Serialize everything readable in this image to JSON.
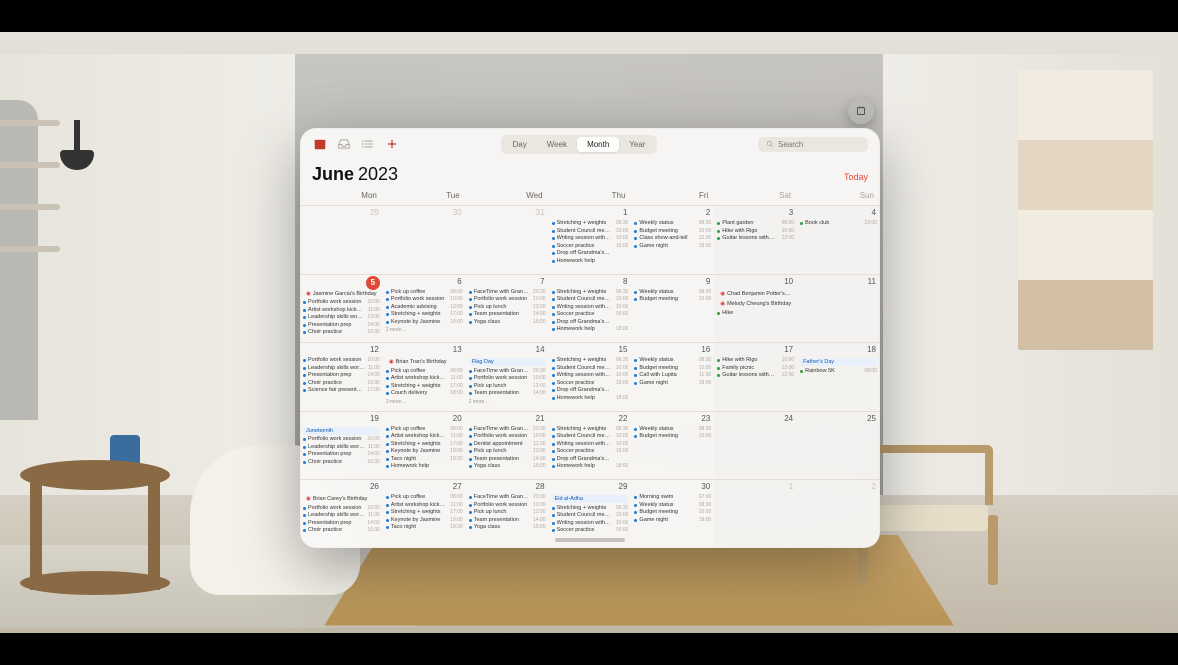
{
  "toolbar": {
    "view_modes": [
      "Day",
      "Week",
      "Month",
      "Year"
    ],
    "active_mode": "Month",
    "search_placeholder": "Search"
  },
  "header": {
    "month": "June",
    "year": "2023",
    "today_label": "Today"
  },
  "days_of_week": [
    "Mon",
    "Tue",
    "Wed",
    "Thu",
    "Fri",
    "Sat",
    "Sun"
  ],
  "today": 5,
  "weeks": [
    [
      {
        "n": 29,
        "dim": true,
        "events": []
      },
      {
        "n": 30,
        "dim": true,
        "events": []
      },
      {
        "n": 31,
        "dim": true,
        "events": []
      },
      {
        "n": 1,
        "events": [
          {
            "t": "Stretching + weights",
            "time": "06:30"
          },
          {
            "t": "Student Council mee…",
            "time": "10:00"
          },
          {
            "t": "Writing session with…",
            "time": "10:00"
          },
          {
            "t": "Soccer practice",
            "time": "16:00"
          },
          {
            "t": "Drop off Grandma's…",
            "time": ""
          },
          {
            "t": "Homework help",
            "time": ""
          }
        ]
      },
      {
        "n": 2,
        "events": [
          {
            "t": "Weekly status",
            "time": "08:30"
          },
          {
            "t": "Budget meeting",
            "time": "10:00"
          },
          {
            "t": "Class show-and-tell",
            "time": "12:00"
          },
          {
            "t": "Game night",
            "time": "19:00"
          }
        ]
      },
      {
        "n": 3,
        "events": [
          {
            "t": "Plant garden",
            "time": "09:00",
            "c": "green"
          },
          {
            "t": "Hike with Rigo",
            "time": "10:00",
            "c": "green"
          },
          {
            "t": "Guitar lessons with…",
            "time": "12:00",
            "c": "green"
          }
        ]
      },
      {
        "n": 4,
        "events": [
          {
            "t": "Book club",
            "time": "12:00",
            "c": "green"
          }
        ]
      }
    ],
    [
      {
        "n": 5,
        "today": true,
        "alldays": [
          {
            "kind": "bday",
            "t": "Jasmine Garcia's Birthday"
          }
        ],
        "events": [
          {
            "t": "Portfolio work session",
            "time": "10:00"
          },
          {
            "t": "Artist workshop kick…",
            "time": "11:00"
          },
          {
            "t": "Leadership skills wor…",
            "time": "13:00"
          },
          {
            "t": "Presentation prep",
            "time": "14:00"
          },
          {
            "t": "Choir practice",
            "time": "16:30"
          }
        ]
      },
      {
        "n": 6,
        "events": [
          {
            "t": "Pick up coffee",
            "time": "08:00"
          },
          {
            "t": "Portfolio work session",
            "time": "10:00"
          },
          {
            "t": "Academic advising",
            "time": "13:00"
          },
          {
            "t": "Stretching + weights",
            "time": "17:00"
          },
          {
            "t": "Keynote by Jasmine",
            "time": "19:00"
          }
        ],
        "more": "2 more…"
      },
      {
        "n": 7,
        "events": [
          {
            "t": "FaceTime with Gran…",
            "time": "20:30"
          },
          {
            "t": "Portfolio work session",
            "time": "10:00"
          },
          {
            "t": "Pick up lunch",
            "time": "12:00"
          },
          {
            "t": "Team presentation",
            "time": "14:00"
          },
          {
            "t": "Yoga class",
            "time": "15:00"
          }
        ]
      },
      {
        "n": 8,
        "events": [
          {
            "t": "Stretching + weights",
            "time": "06:30"
          },
          {
            "t": "Student Council mee…",
            "time": "10:00"
          },
          {
            "t": "Writing session with…",
            "time": "10:00"
          },
          {
            "t": "Soccer practice",
            "time": "16:00"
          },
          {
            "t": "Drop off Grandma's…",
            "time": ""
          },
          {
            "t": "Homework help",
            "time": "18:00"
          }
        ]
      },
      {
        "n": 9,
        "events": [
          {
            "t": "Weekly status",
            "time": "08:30"
          },
          {
            "t": "Budget meeting",
            "time": "10:00"
          }
        ]
      },
      {
        "n": 10,
        "alldays": [
          {
            "kind": "bday",
            "t": "Chad Benjamin Potter's Bi…"
          },
          {
            "kind": "bday",
            "t": "Melody Cheung's Birthday"
          }
        ],
        "events": [
          {
            "t": "Hike",
            "time": "",
            "c": "green"
          }
        ]
      },
      {
        "n": 11,
        "events": []
      }
    ],
    [
      {
        "n": 12,
        "events": [
          {
            "t": "Portfolio work session",
            "time": "10:00"
          },
          {
            "t": "Leadership skills wor…",
            "time": "11:00"
          },
          {
            "t": "Presentation prep",
            "time": "14:00"
          },
          {
            "t": "Choir practice",
            "time": "16:30"
          },
          {
            "t": "Science fair presenta…",
            "time": "17:00"
          }
        ]
      },
      {
        "n": 13,
        "alldays": [
          {
            "kind": "bday",
            "t": "Brian Tran's Birthday"
          }
        ],
        "events": [
          {
            "t": "Pick up coffee",
            "time": "08:00"
          },
          {
            "t": "Artist workshop kick…",
            "time": "11:00"
          },
          {
            "t": "Stretching + weights",
            "time": "17:00"
          },
          {
            "t": "Couch delivery",
            "time": "18:00"
          }
        ],
        "more": "3 more…"
      },
      {
        "n": 14,
        "alldays": [
          {
            "kind": "hol",
            "t": "Flag Day"
          }
        ],
        "events": [
          {
            "t": "FaceTime with Gran…",
            "time": "20:30"
          },
          {
            "t": "Portfolio work session",
            "time": "10:00"
          },
          {
            "t": "Pick up lunch",
            "time": "12:00"
          },
          {
            "t": "Team presentation",
            "time": "14:00"
          }
        ],
        "more": "2 more…"
      },
      {
        "n": 15,
        "events": [
          {
            "t": "Stretching + weights",
            "time": "06:30"
          },
          {
            "t": "Student Council mee…",
            "time": "10:00"
          },
          {
            "t": "Writing session with…",
            "time": "10:00"
          },
          {
            "t": "Soccer practice",
            "time": "16:00"
          },
          {
            "t": "Drop off Grandma's…",
            "time": ""
          },
          {
            "t": "Homework help",
            "time": "18:00"
          }
        ]
      },
      {
        "n": 16,
        "events": [
          {
            "t": "Weekly status",
            "time": "08:30"
          },
          {
            "t": "Budget meeting",
            "time": "10:00"
          },
          {
            "t": "Call with Lupita",
            "time": "11:30"
          },
          {
            "t": "Game night",
            "time": "19:00"
          }
        ]
      },
      {
        "n": 17,
        "events": [
          {
            "t": "Hike with Rigo",
            "time": "10:00",
            "c": "green"
          },
          {
            "t": "Family picnic",
            "time": "12:00",
            "c": "green"
          },
          {
            "t": "Guitar lessons with…",
            "time": "12:00",
            "c": "green"
          }
        ]
      },
      {
        "n": 18,
        "alldays": [
          {
            "kind": "hol",
            "t": "Father's Day"
          }
        ],
        "events": [
          {
            "t": "Rainbow 5K",
            "time": "08:00",
            "c": "green"
          }
        ]
      }
    ],
    [
      {
        "n": 19,
        "alldays": [
          {
            "kind": "hol",
            "t": "Juneteenth"
          }
        ],
        "events": [
          {
            "t": "Portfolio work session",
            "time": "10:00"
          },
          {
            "t": "Leadership skills wor…",
            "time": "11:00"
          },
          {
            "t": "Presentation prep",
            "time": "14:00"
          },
          {
            "t": "Choir practice",
            "time": "16:30"
          }
        ]
      },
      {
        "n": 20,
        "events": [
          {
            "t": "Pick up coffee",
            "time": "08:00"
          },
          {
            "t": "Artist workshop kick…",
            "time": "11:00"
          },
          {
            "t": "Stretching + weights",
            "time": "17:00"
          },
          {
            "t": "Keynote by Jasmine",
            "time": "19:00"
          },
          {
            "t": "Taco night",
            "time": "19:30"
          },
          {
            "t": "Homework help",
            "time": ""
          }
        ]
      },
      {
        "n": 21,
        "events": [
          {
            "t": "FaceTime with Gran…",
            "time": "20:30"
          },
          {
            "t": "Portfolio work session",
            "time": "10:00"
          },
          {
            "t": "Dentist appointment",
            "time": "11:30"
          },
          {
            "t": "Pick up lunch",
            "time": "12:00"
          },
          {
            "t": "Team presentation",
            "time": "14:00"
          },
          {
            "t": "Yoga class",
            "time": "15:00"
          }
        ]
      },
      {
        "n": 22,
        "events": [
          {
            "t": "Stretching + weights",
            "time": "06:30"
          },
          {
            "t": "Student Council mee…",
            "time": "10:00"
          },
          {
            "t": "Writing session with…",
            "time": "10:00"
          },
          {
            "t": "Soccer practice",
            "time": "16:00"
          },
          {
            "t": "Drop off Grandma's…",
            "time": ""
          },
          {
            "t": "Homework help",
            "time": "18:00"
          }
        ]
      },
      {
        "n": 23,
        "events": [
          {
            "t": "Weekly status",
            "time": "08:30"
          },
          {
            "t": "Budget meeting",
            "time": "10:00"
          }
        ]
      },
      {
        "n": 24,
        "events": []
      },
      {
        "n": 25,
        "events": []
      }
    ],
    [
      {
        "n": 26,
        "alldays": [
          {
            "kind": "bday",
            "t": "Brian Carey's Birthday"
          }
        ],
        "events": [
          {
            "t": "Portfolio work session",
            "time": "10:00"
          },
          {
            "t": "Leadership skills wor…",
            "time": "11:00"
          },
          {
            "t": "Presentation prep",
            "time": "14:00"
          },
          {
            "t": "Choir practice",
            "time": "16:30"
          }
        ]
      },
      {
        "n": 27,
        "events": [
          {
            "t": "Pick up coffee",
            "time": "08:00"
          },
          {
            "t": "Artist workshop kick…",
            "time": "11:00"
          },
          {
            "t": "Stretching + weights",
            "time": "17:00"
          },
          {
            "t": "Keynote by Jasmine",
            "time": "19:00"
          },
          {
            "t": "Taco night",
            "time": "19:30"
          }
        ]
      },
      {
        "n": 28,
        "events": [
          {
            "t": "FaceTime with Gran…",
            "time": "20:30"
          },
          {
            "t": "Portfolio work session",
            "time": "10:00"
          },
          {
            "t": "Pick up lunch",
            "time": "12:00"
          },
          {
            "t": "Team presentation",
            "time": "14:00"
          },
          {
            "t": "Yoga class",
            "time": "15:00"
          }
        ]
      },
      {
        "n": 29,
        "alldays": [
          {
            "kind": "hol",
            "t": "Eid al-Adha"
          }
        ],
        "events": [
          {
            "t": "Stretching + weights",
            "time": "06:30"
          },
          {
            "t": "Student Council mee…",
            "time": "10:00"
          },
          {
            "t": "Writing session with…",
            "time": "10:00"
          },
          {
            "t": "Soccer practice",
            "time": "16:00"
          }
        ]
      },
      {
        "n": 30,
        "events": [
          {
            "t": "Morning swim",
            "time": "07:00"
          },
          {
            "t": "Weekly status",
            "time": "08:30"
          },
          {
            "t": "Budget meeting",
            "time": "10:00"
          },
          {
            "t": "Game night",
            "time": "19:00"
          }
        ]
      },
      {
        "n": 1,
        "dim": true,
        "events": []
      },
      {
        "n": 2,
        "dim": true,
        "events": []
      }
    ]
  ]
}
